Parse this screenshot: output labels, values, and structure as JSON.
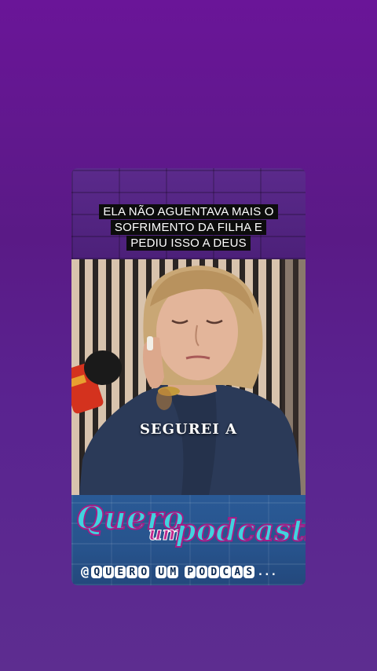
{
  "headline": {
    "line1": "ELA NÃO AGUENTAVA MAIS O",
    "line2": "SOFRIMENTO DA FILHA E",
    "line3": "PEDIU ISSO A DEUS"
  },
  "caption": "SEGUREI A",
  "logo": {
    "word1": "Quero",
    "word2": "um",
    "word3": "podcasts"
  },
  "handle": {
    "at": "@",
    "chars": [
      "Q",
      "U",
      "E",
      "R",
      "O",
      " ",
      "U",
      "M",
      " ",
      "P",
      "O",
      "D",
      "C",
      "A",
      "S"
    ],
    "ellipsis": "..."
  },
  "colors": {
    "background": "#6a1598",
    "logo_cyan": "#41d3de",
    "logo_magenta": "#a21d86",
    "band_blue": "#2a5a96"
  }
}
